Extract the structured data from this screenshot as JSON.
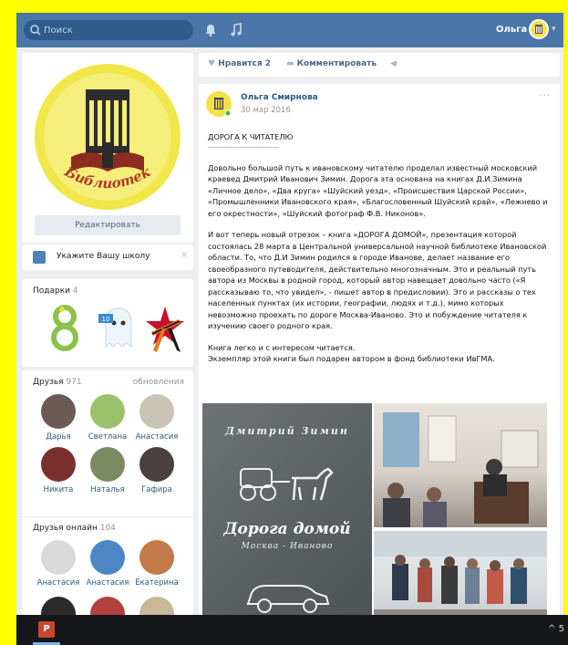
{
  "topbar": {
    "search_placeholder": "Поиск",
    "user_name": "Ольга",
    "icons": [
      "search-icon",
      "bell-icon",
      "music-icon",
      "chevron-down-icon"
    ]
  },
  "profile": {
    "edit_label": "Редактировать",
    "logo_text": "Библиотека ИвГМА"
  },
  "school": {
    "label": "Укажите Вашу школу",
    "close": "×"
  },
  "gifts": {
    "title": "Подарки",
    "count": "4",
    "badge_text": "10"
  },
  "friends": {
    "title": "Друзья",
    "count": "971",
    "updates_label": "обновления",
    "rows": [
      [
        {
          "name": "Дарья",
          "color": "#6b5a55"
        },
        {
          "name": "Светлана",
          "color": "#9bc26a"
        },
        {
          "name": "Анастасия",
          "color": "#c9c4b3"
        }
      ],
      [
        {
          "name": "Никита",
          "color": "#7a2f2f"
        },
        {
          "name": "Наталья",
          "color": "#7b8a60"
        },
        {
          "name": "Гафира",
          "color": "#4c3f3f"
        }
      ]
    ]
  },
  "online": {
    "title": "Друзья онлайн",
    "count": "104",
    "rows": [
      [
        {
          "name": "Анастасия",
          "color": "#d9d9d9"
        },
        {
          "name": "Анастасия",
          "color": "#4d86c4"
        },
        {
          "name": "Екатерина",
          "color": "#c47a4a"
        }
      ],
      [
        {
          "name": "",
          "color": "#2a2a2a"
        },
        {
          "name": "",
          "color": "#b2403e"
        },
        {
          "name": "",
          "color": "#c9b79a"
        }
      ]
    ]
  },
  "actions": {
    "like_label": "Нравится",
    "like_count": "2",
    "comment_label": "Комментировать"
  },
  "post": {
    "author": "Ольга Смирнова",
    "date": "30 мар 2016",
    "dots": "···",
    "title": "ДОРОГА К ЧИТАТЕЛЮ",
    "rule": "------------------------------------",
    "p1": "Довольно большой путь к ивановскому читателю проделал известный московский краевед Дмитрий Иванович Зимин. Дорога эта основана на книгах Д.И.Зимина «Личное дело», «Два круга» «Шуйский уезд», «Происшествия Царской России», «Промышленники Ивановского края», «Благословенный Шуйский край», «Лежнево и его окрестности», «Шуйский фотограф Ф.В. Никонов».",
    "p2": "И вот теперь новый отрезок – книга «ДОРОГА ДОМОЙ», презентация которой состоялась 28 марта в Центральной универсальной научной библиотеке Ивановской области. То, что Д.И Зимин родился в городе Иванове, делает название его своеобразного путеводителя, действительно многозначным. Это и реальный путь автора из Москвы в родной город, который автор навещает довольно часто («Я рассказываю то, что увидел», - пишет автор в предисловии). Это и рассказы о тех населенных пунктах (их истории, географии, людях и т.д.), мимо которых невозможно проехать по дороге Москва-Иваново. Это и побуждение читателя к изучению своего родного края.",
    "p3": "Книга легко и с интересом читается.",
    "p4": "Экземпляр этой книги был подарен автором в фонд библиотеки ИвГМА.",
    "book": {
      "author": "Дмитрий Зимин",
      "title": "Дорога домой",
      "subtitle": "Москва - Иваново"
    }
  },
  "taskbar": {
    "app_label": "P",
    "tray": "^ 5"
  }
}
